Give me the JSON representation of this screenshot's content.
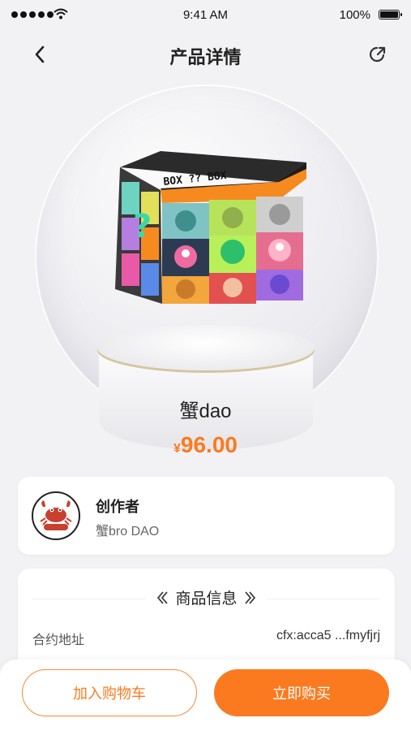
{
  "status_bar": {
    "time": "9:41 AM",
    "battery": "100%"
  },
  "nav": {
    "title": "产品详情",
    "back_icon": "chevron-left-icon",
    "share_icon": "share-arrow-icon"
  },
  "product": {
    "box_label": "BOX ?? BOX",
    "name": "蟹dao",
    "price_currency": "¥",
    "price": "96.00"
  },
  "creator": {
    "label": "创作者",
    "name": "蟹bro DAO",
    "avatar_icon": "crab-logo-icon"
  },
  "info": {
    "title": "商品信息",
    "contract_label": "合约地址",
    "contract_value": "cfx:acca5 ...fmyfjrj"
  },
  "actions": {
    "add_to_cart": "加入购物车",
    "buy_now": "立即购买"
  },
  "colors": {
    "accent": "#fb7a1f",
    "background": "#f2f2f4"
  }
}
